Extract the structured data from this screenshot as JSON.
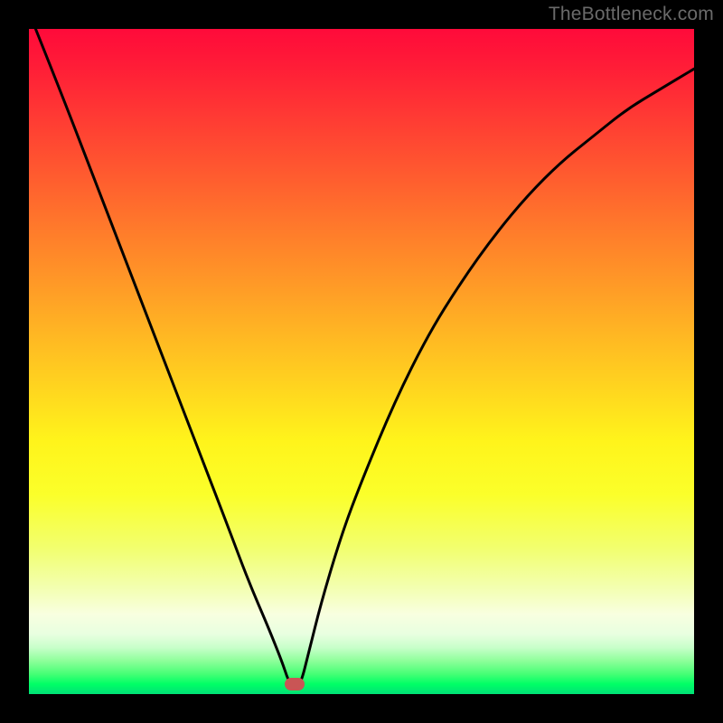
{
  "watermark": "TheBottleneck.com",
  "chart_data": {
    "type": "line",
    "title": "",
    "xlabel": "",
    "ylabel": "",
    "xlim": [
      0,
      100
    ],
    "ylim": [
      0,
      100
    ],
    "grid": false,
    "legend": false,
    "notch_x": 40,
    "marker": {
      "x": 40,
      "y": 1.5,
      "color": "#c95555"
    },
    "series": [
      {
        "name": "bottleneck-curve",
        "color": "#000000",
        "x": [
          1,
          5,
          10,
          15,
          20,
          25,
          30,
          33,
          36,
          38,
          39,
          40,
          41,
          42,
          44,
          47,
          50,
          55,
          60,
          65,
          70,
          75,
          80,
          85,
          90,
          95,
          100
        ],
        "values": [
          100,
          90,
          77,
          64,
          51,
          38,
          25,
          17,
          10,
          5,
          2,
          0.5,
          2,
          6,
          14,
          24,
          32,
          44,
          54,
          62,
          69,
          75,
          80,
          84,
          88,
          91,
          94
        ]
      }
    ],
    "background_gradient": {
      "top": "#ff0a3a",
      "mid": "#fff41b",
      "bottom": "#00ff66"
    }
  }
}
